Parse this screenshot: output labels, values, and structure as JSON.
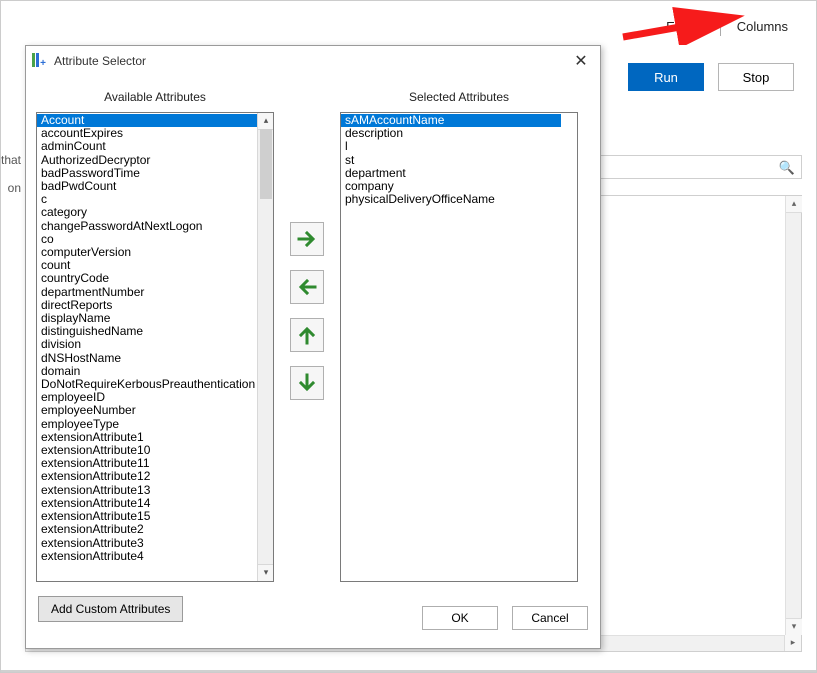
{
  "toolbar": {
    "export_label": "Export",
    "columns_label": "Columns",
    "run_label": "Run",
    "stop_label": "Stop"
  },
  "bg": {
    "fragment1": "that",
    "fragment2": "on"
  },
  "dialog": {
    "title": "Attribute Selector",
    "available_header": "Available Attributes",
    "selected_header": "Selected Attributes",
    "add_custom_label": "Add Custom Attributes",
    "ok_label": "OK",
    "cancel_label": "Cancel"
  },
  "available": {
    "selected_index": 0,
    "items": [
      "Account",
      "accountExpires",
      "adminCount",
      "AuthorizedDecryptor",
      "badPasswordTime",
      "badPwdCount",
      "c",
      "category",
      "changePasswordAtNextLogon",
      "co",
      "computerVersion",
      "count",
      "countryCode",
      "departmentNumber",
      "directReports",
      "displayName",
      "distinguishedName",
      "division",
      "dNSHostName",
      "domain",
      "DoNotRequireKerbousPreauthentication",
      "employeeID",
      "employeeNumber",
      "employeeType",
      "extensionAttribute1",
      "extensionAttribute10",
      "extensionAttribute11",
      "extensionAttribute12",
      "extensionAttribute13",
      "extensionAttribute14",
      "extensionAttribute15",
      "extensionAttribute2",
      "extensionAttribute3",
      "extensionAttribute4"
    ]
  },
  "selected": {
    "selected_index": 0,
    "items": [
      "sAMAccountName",
      "description",
      "l",
      "st",
      "department",
      "company",
      "physicalDeliveryOfficeName"
    ]
  },
  "icons": {
    "move_right": "arrow-right",
    "move_left": "arrow-left",
    "move_up": "arrow-up",
    "move_down": "arrow-down"
  }
}
